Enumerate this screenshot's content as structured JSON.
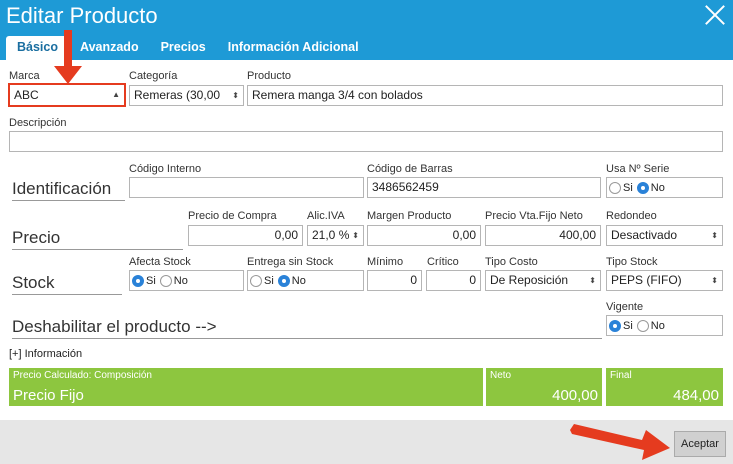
{
  "window": {
    "title": "Editar Producto"
  },
  "tabs": [
    "Básico",
    "Avanzado",
    "Precios",
    "Información Adicional"
  ],
  "fields": {
    "marca": {
      "label": "Marca",
      "value": "ABC"
    },
    "categoria": {
      "label": "Categoría",
      "value": "Remeras (30,00"
    },
    "producto": {
      "label": "Producto",
      "value": "Remera manga 3/4 con bolados"
    },
    "descripcion": {
      "label": "Descripción",
      "value": ""
    },
    "codigo_interno": {
      "label": "Código Interno",
      "value": ""
    },
    "codigo_barras": {
      "label": "Código de Barras",
      "value": "3486562459"
    },
    "usa_serie": {
      "label": "Usa Nº Serie",
      "options": [
        "Si",
        "No"
      ],
      "selected": "No"
    },
    "precio_compra": {
      "label": "Precio de Compra",
      "value": "0,00"
    },
    "alic_iva": {
      "label": "Alic.IVA",
      "value": "21,0 %"
    },
    "margen": {
      "label": "Margen Producto",
      "value": "0,00"
    },
    "precio_vta": {
      "label": "Precio Vta.Fijo Neto",
      "value": "400,00"
    },
    "redondeo": {
      "label": "Redondeo",
      "value": "Desactivado"
    },
    "afecta_stock": {
      "label": "Afecta Stock",
      "options": [
        "Si",
        "No"
      ],
      "selected": "Si"
    },
    "entrega_sin_stock": {
      "label": "Entrega sin Stock",
      "options": [
        "Si",
        "No"
      ],
      "selected": "No"
    },
    "minimo": {
      "label": "Mínimo",
      "value": "0"
    },
    "critico": {
      "label": "Crítico",
      "value": "0"
    },
    "tipo_costo": {
      "label": "Tipo Costo",
      "value": "De Reposición"
    },
    "tipo_stock": {
      "label": "Tipo Stock",
      "value": "PEPS (FIFO)"
    },
    "vigente": {
      "label": "Vigente",
      "options": [
        "Si",
        "No"
      ],
      "selected": "Si"
    }
  },
  "sections": {
    "identificacion": "Identificación",
    "precio": "Precio",
    "stock": "Stock",
    "deshabilitar": "Deshabilitar el producto -->"
  },
  "info_link": "[+] Información",
  "summary": {
    "composicion_caption": "Precio Calculado: Composición",
    "composicion_value": "Precio Fijo",
    "neto_caption": "Neto",
    "neto_value": "400,00",
    "final_caption": "Final",
    "final_value": "484,00"
  },
  "footer": {
    "accept_label": "Aceptar"
  },
  "colors": {
    "header": "#1e9ad6",
    "summary": "#8dc63f",
    "annotation": "#e53b1f"
  },
  "annotations": [
    "red-arrow-to-marca",
    "red-arrow-to-aceptar"
  ]
}
